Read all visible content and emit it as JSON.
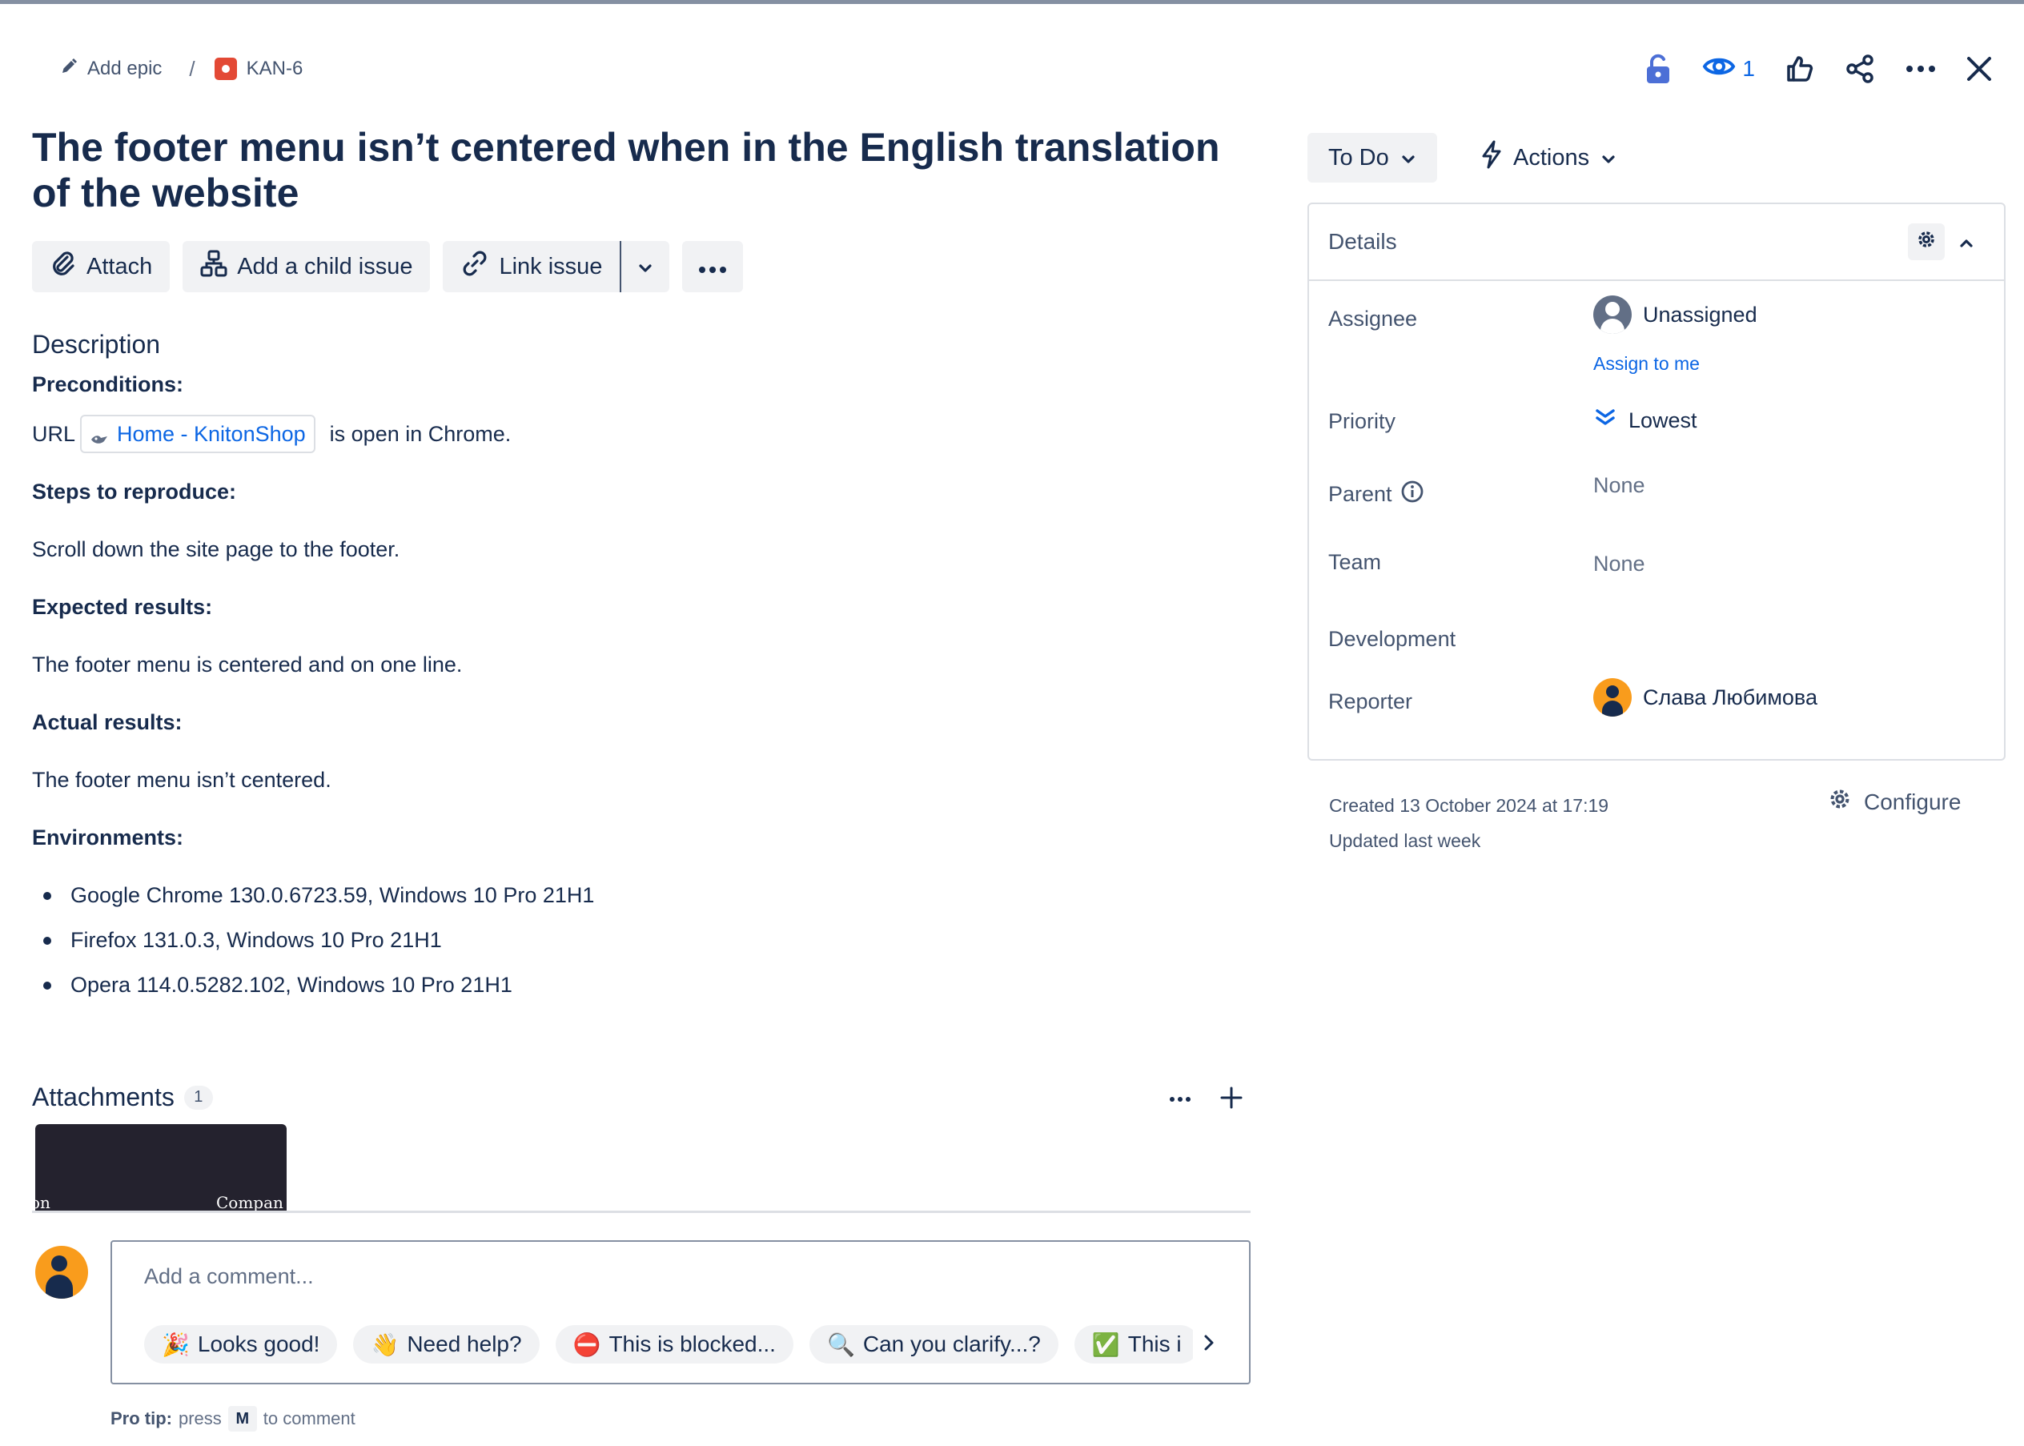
{
  "breadcrumb": {
    "add_epic": "Add epic",
    "separator": "/",
    "issue_key": "KAN-6",
    "issue_type_icon": "bug-icon",
    "issue_type_color": "#e34935"
  },
  "header_actions": {
    "watchers_count": "1",
    "icons": [
      "lock-open-icon",
      "eye-icon",
      "thumbs-up-icon",
      "share-icon",
      "more-icon",
      "close-icon"
    ]
  },
  "issue": {
    "title": "The footer menu isn’t centered when in the English translation of the website"
  },
  "toolbar": {
    "attach": "Attach",
    "add_child": "Add a child issue",
    "link_issue": "Link issue"
  },
  "description": {
    "heading": "Description",
    "preconditions_label": "Preconditions:",
    "url_prefix": "URL",
    "link_text": "Home - KnitonShop",
    "url_suffix": "is open in Chrome.",
    "steps_label": "Steps to reproduce:",
    "steps_text": "Scroll down the site page to the footer.",
    "expected_label": "Expected results:",
    "expected_text": "The footer menu is centered and on one line.",
    "actual_label": "Actual results:",
    "actual_text": "The footer menu isn’t centered.",
    "env_label": "Environments:",
    "environments": [
      "Google Chrome 130.0.6723.59, Windows 10 Pro 21H1",
      "Firefox 131.0.3, Windows 10 Pro 21H1",
      "Opera 114.0.5282.102, Windows 10 Pro 21H1"
    ]
  },
  "attachments": {
    "heading": "Attachments",
    "count": "1",
    "thumbnail_text_left": "on",
    "thumbnail_text_right": "Compan"
  },
  "comment": {
    "placeholder": "Add a comment...",
    "quick_replies": [
      {
        "emoji": "🎉",
        "label": "Looks good!"
      },
      {
        "emoji": "👋",
        "label": "Need help?"
      },
      {
        "emoji": "⛔",
        "label": "This is blocked..."
      },
      {
        "emoji": "🔍",
        "label": "Can you clarify...?"
      },
      {
        "emoji": "✅",
        "label": "This i"
      }
    ],
    "pro_tip_bold": "Pro tip:",
    "pro_tip_press": "press",
    "pro_tip_key": "M",
    "pro_tip_rest": "to comment"
  },
  "status": {
    "label": "To Do",
    "actions_label": "Actions"
  },
  "details": {
    "heading": "Details",
    "assignee_label": "Assignee",
    "assignee_value": "Unassigned",
    "assign_to_me": "Assign to me",
    "priority_label": "Priority",
    "priority_value": "Lowest",
    "parent_label": "Parent",
    "parent_value": "None",
    "team_label": "Team",
    "team_value": "None",
    "development_label": "Development",
    "reporter_label": "Reporter",
    "reporter_value": "Слава Любимова"
  },
  "meta": {
    "created": "Created 13 October 2024 at 17:19",
    "updated": "Updated last week",
    "configure": "Configure"
  },
  "colors": {
    "text": "#172b4d",
    "link": "#0c66e4",
    "avatar_orange": "#f99c1c",
    "button_bg": "#f1f2f4"
  }
}
